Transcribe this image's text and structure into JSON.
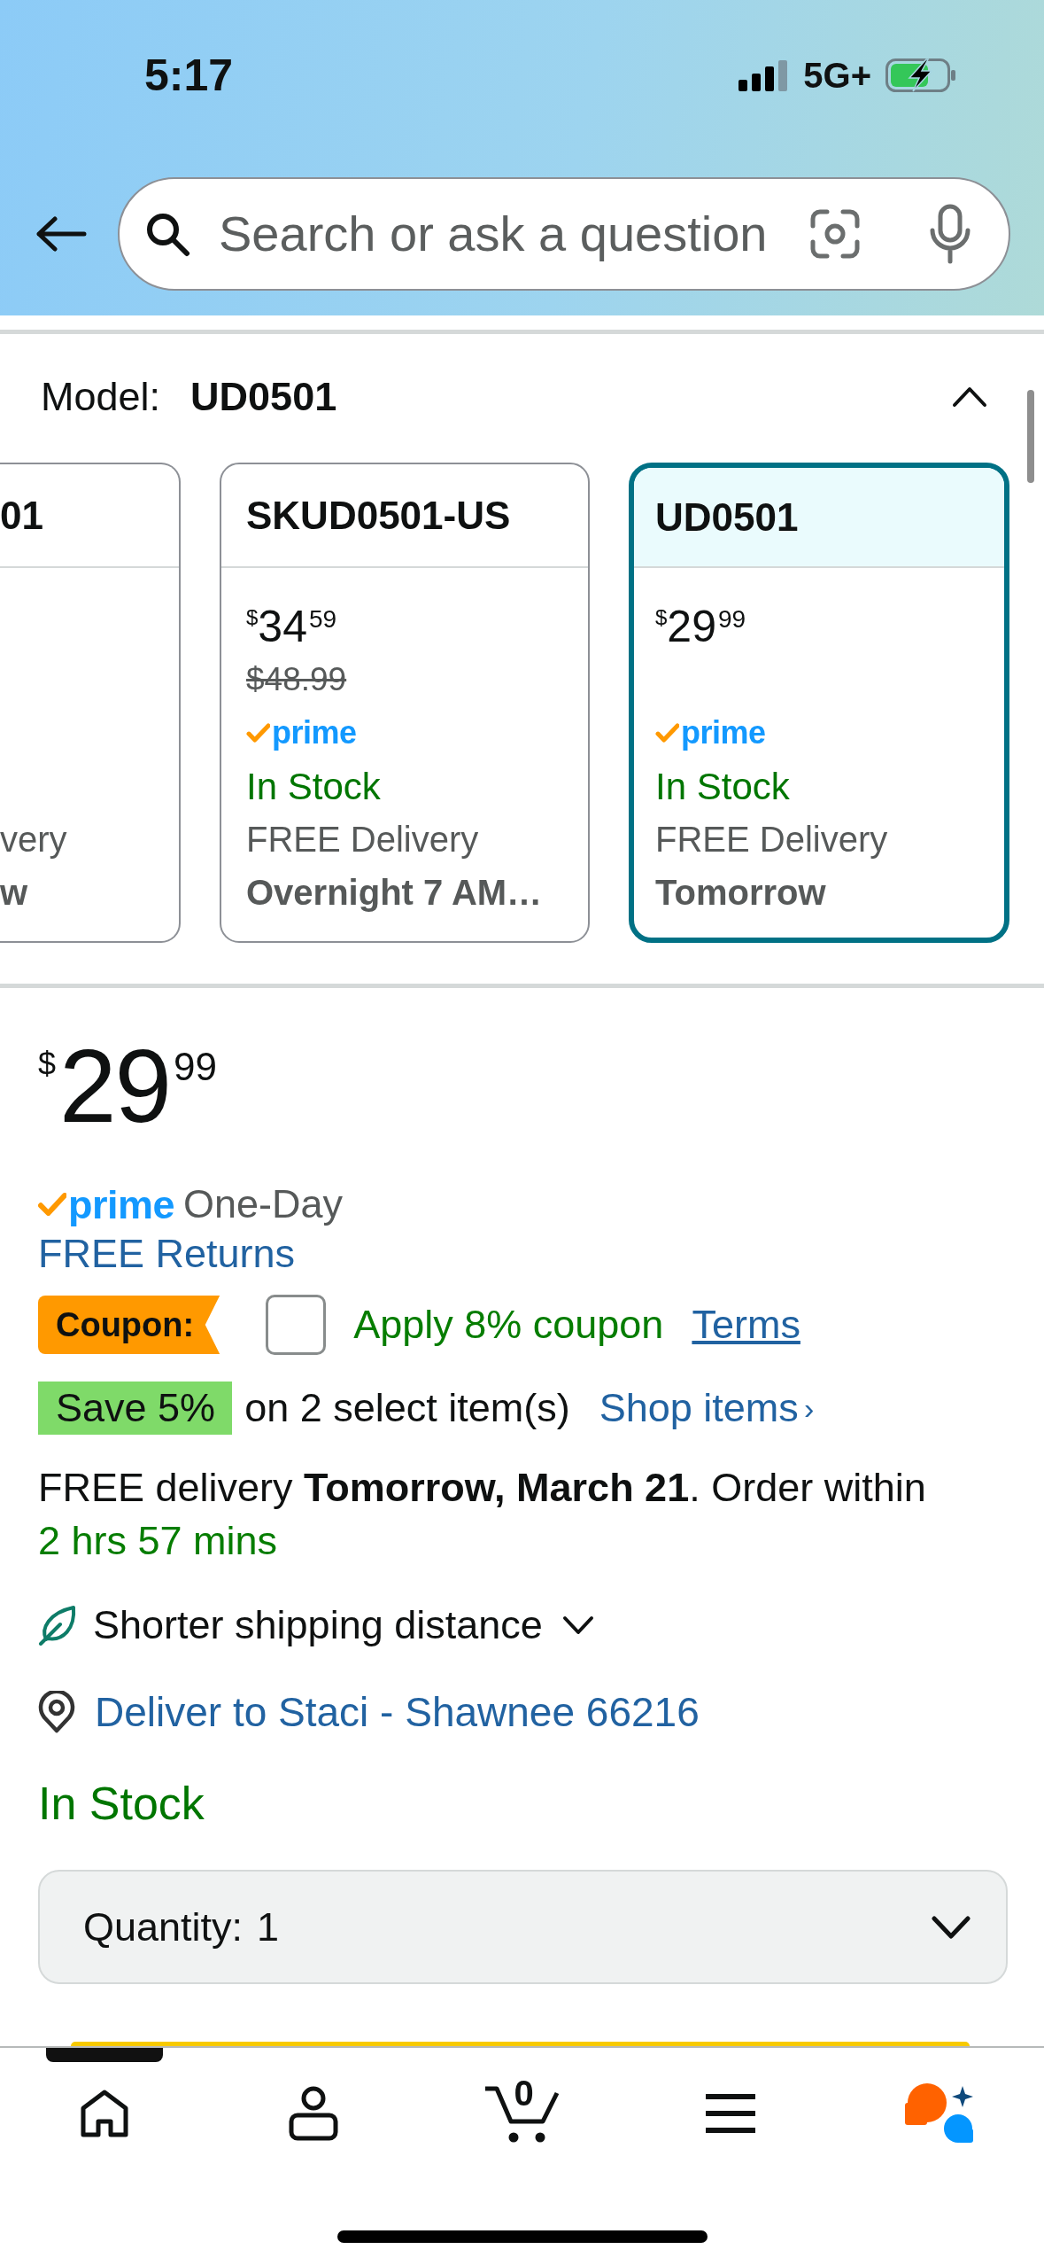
{
  "status_bar": {
    "time": "5:17",
    "network": "5G+"
  },
  "search": {
    "placeholder": "Search or ask a question"
  },
  "model": {
    "label": "Model:",
    "value": "UD0501",
    "expanded": true,
    "options": [
      {
        "title": "01",
        "selected": false,
        "delivery": "very",
        "delivery_date": "w"
      },
      {
        "title": "SKUD0501-US",
        "selected": false,
        "price": {
          "symbol": "$",
          "whole": "34",
          "fraction": "59"
        },
        "list_price": "$48.99",
        "prime": "prime",
        "availability": "In Stock",
        "delivery": "FREE Delivery",
        "delivery_date": "Overnight 7 AM…"
      },
      {
        "title": "UD0501",
        "selected": true,
        "price": {
          "symbol": "$",
          "whole": "29",
          "fraction": "99"
        },
        "prime": "prime",
        "availability": "In Stock",
        "delivery": "FREE Delivery",
        "delivery_date": "Tomorrow"
      }
    ]
  },
  "buy_box": {
    "price": {
      "symbol": "$",
      "whole": "29",
      "fraction": "99"
    },
    "prime": "prime",
    "prime_label": "One-Day",
    "returns_link": "FREE Returns",
    "coupon": {
      "badge": "Coupon:",
      "checked": false,
      "label": "Apply 8% coupon",
      "terms_link": "Terms"
    },
    "promotion": {
      "badge": "Save 5%",
      "text": "on 2 select item(s)",
      "link": "Shop items",
      "link_chevron": "›"
    },
    "delivery": {
      "text": "FREE delivery **Tomorrow, March 21**. Order within",
      "countdown": "2 hrs 57 mins"
    },
    "shipping_note": {
      "label": "Shorter shipping distance",
      "expanded": false
    },
    "deliver_to": "Deliver to Staci - Shawnee 66216",
    "availability": "In Stock",
    "quantity": {
      "label": "Quantity:",
      "value": "1"
    }
  },
  "bottom_nav": [
    {
      "kind": "home",
      "selected": true
    },
    {
      "kind": "account",
      "selected": false
    },
    {
      "kind": "cart",
      "selected": false,
      "count": "0"
    },
    {
      "kind": "menu",
      "selected": false
    },
    {
      "kind": "assistant",
      "selected": false
    }
  ]
}
